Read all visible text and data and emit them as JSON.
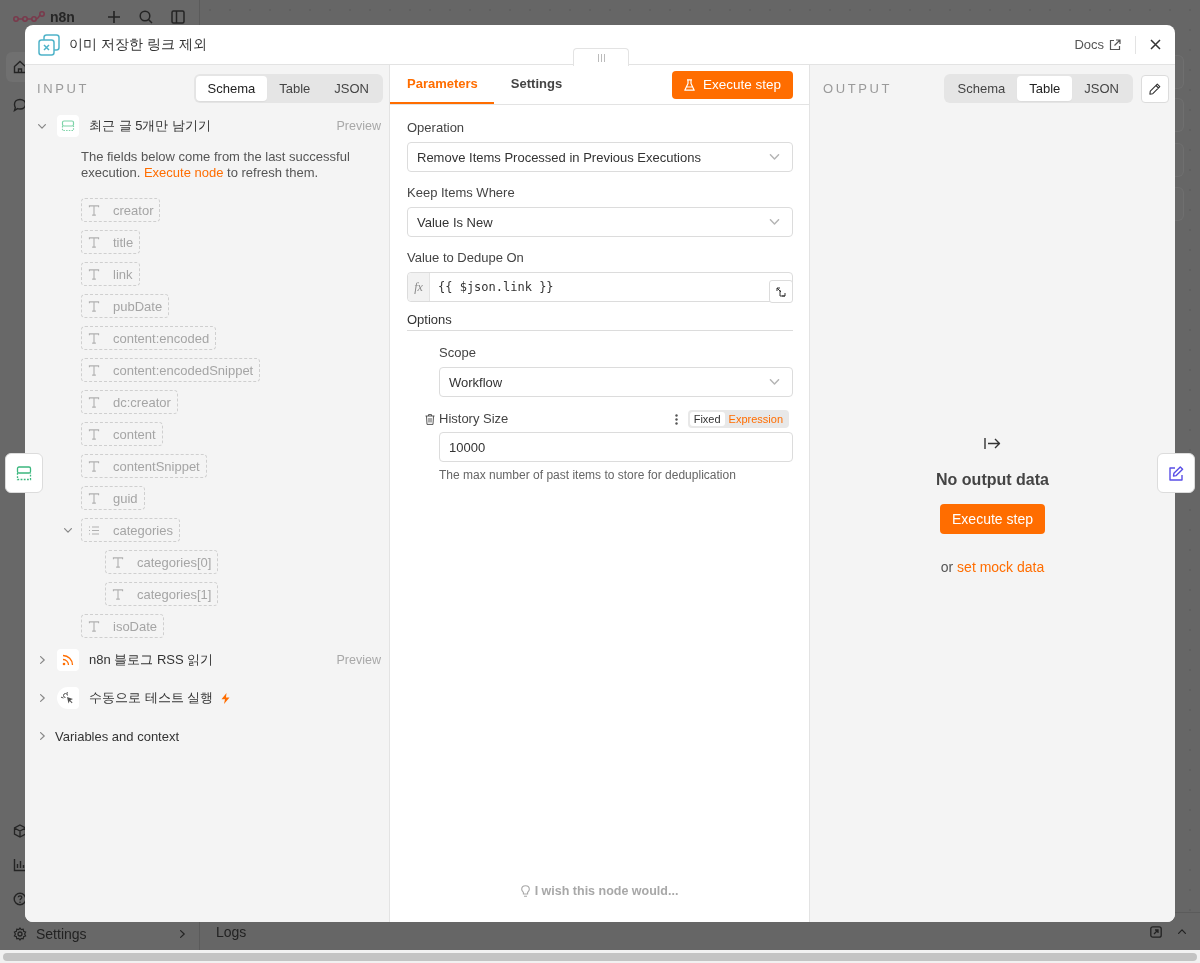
{
  "app_sidebar": {
    "brand": "n8n",
    "settings_label": "Settings"
  },
  "logs_bar": {
    "label": "Logs"
  },
  "dialog": {
    "title": "이미 저장한 링크 제외",
    "docs_label": "Docs"
  },
  "input_panel": {
    "heading": "INPUT",
    "view_tabs": [
      {
        "label": "Schema",
        "selected": true
      },
      {
        "label": "Table",
        "selected": false
      },
      {
        "label": "JSON",
        "selected": false
      }
    ],
    "nodes": [
      {
        "name": "최근 글 5개만 남기기",
        "kind": "dedupe",
        "expanded": true,
        "preview": "Preview",
        "trigger": false,
        "note": {
          "text": "The fields below come from the last successful execution.",
          "link": "Execute node",
          "after": "to refresh them."
        },
        "fields": [
          {
            "name": "creator",
            "kind": "string"
          },
          {
            "name": "title",
            "kind": "string"
          },
          {
            "name": "link",
            "kind": "string"
          },
          {
            "name": "pubDate",
            "kind": "string"
          },
          {
            "name": "content:encoded",
            "kind": "string"
          },
          {
            "name": "content:encodedSnippet",
            "kind": "string"
          },
          {
            "name": "dc:creator",
            "kind": "string"
          },
          {
            "name": "content",
            "kind": "string"
          },
          {
            "name": "contentSnippet",
            "kind": "string"
          },
          {
            "name": "guid",
            "kind": "string"
          },
          {
            "name": "categories",
            "kind": "array",
            "expanded": true,
            "children": [
              {
                "name": "categories[0]",
                "kind": "string"
              },
              {
                "name": "categories[1]",
                "kind": "string"
              }
            ]
          },
          {
            "name": "isoDate",
            "kind": "string"
          }
        ]
      },
      {
        "name": "n8n 블로그 RSS 읽기",
        "kind": "rss",
        "expanded": false,
        "preview": "Preview",
        "trigger": false
      },
      {
        "name": "수동으로 테스트 실행",
        "kind": "manual",
        "expanded": false,
        "trigger": true
      }
    ],
    "context": {
      "label": "Variables and context",
      "expanded": false
    }
  },
  "parameters_panel": {
    "tabs": [
      {
        "label": "Parameters",
        "selected": true
      },
      {
        "label": "Settings",
        "selected": false
      }
    ],
    "execute_button": "Execute step",
    "fields": [
      {
        "kind": "select",
        "label": "Operation",
        "value": "Remove Items Processed in Previous Executions"
      },
      {
        "kind": "select",
        "label": "Keep Items Where",
        "value": "Value Is New"
      },
      {
        "kind": "expression",
        "label": "Value to Dedupe On",
        "prefix": "fx",
        "value": "{{ $json.link }}"
      }
    ],
    "options": {
      "heading": "Options",
      "fields": [
        {
          "kind": "select",
          "label": "Scope",
          "value": "Workflow"
        },
        {
          "kind": "number",
          "label": "History Size",
          "value": "10000",
          "hint": "The max number of past items to store for deduplication",
          "modes": [
            {
              "label": "Fixed",
              "selected": true
            },
            {
              "label": "Expression",
              "selected": false
            }
          ]
        }
      ]
    },
    "feedback": "I wish this node would..."
  },
  "output_panel": {
    "heading": "OUTPUT",
    "view_tabs": [
      {
        "label": "Schema",
        "selected": false
      },
      {
        "label": "Table",
        "selected": true
      },
      {
        "label": "JSON",
        "selected": false
      }
    ],
    "empty_title": "No output data",
    "execute_button": "Execute step",
    "alt_text": "or",
    "alt_link": "set mock data"
  }
}
